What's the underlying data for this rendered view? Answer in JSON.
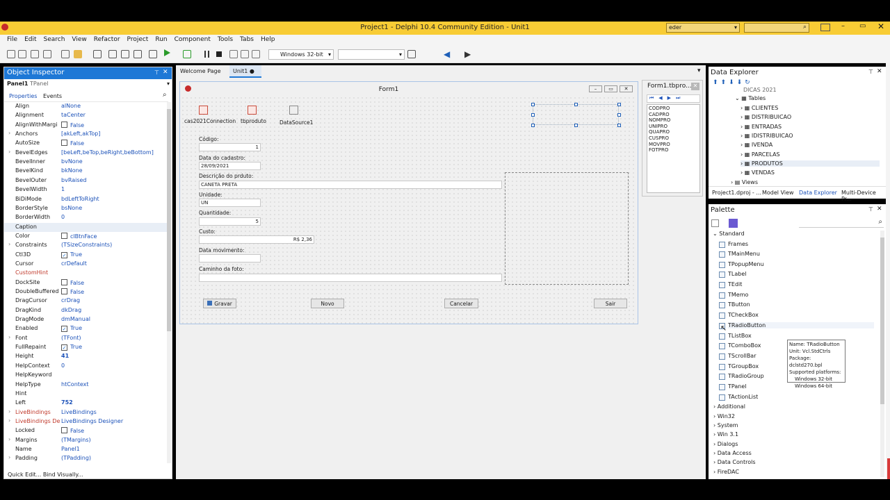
{
  "window": {
    "title": "Project1 - Delphi 10.4 Community Edition - Unit1",
    "user_combo": "eder"
  },
  "menu": [
    "File",
    "Edit",
    "Search",
    "View",
    "Refactor",
    "Project",
    "Run",
    "Component",
    "Tools",
    "Tabs",
    "Help"
  ],
  "toolbar": {
    "platform": "Windows 32-bit"
  },
  "object_inspector": {
    "title": "Object Inspector",
    "selected": "Panel1",
    "selected_type": "TPanel",
    "tabs": [
      "Properties",
      "Events"
    ],
    "properties": [
      {
        "name": "Align",
        "value": "alNone"
      },
      {
        "name": "Alignment",
        "value": "taCenter"
      },
      {
        "name": "AlignWithMargi",
        "value": "False",
        "check": "off"
      },
      {
        "name": "Anchors",
        "value": "[akLeft,akTop]"
      },
      {
        "name": "AutoSize",
        "value": "False",
        "check": "off"
      },
      {
        "name": "BevelEdges",
        "value": "[beLeft,beTop,beRight,beBottom]"
      },
      {
        "name": "BevelInner",
        "value": "bvNone"
      },
      {
        "name": "BevelKind",
        "value": "bkNone"
      },
      {
        "name": "BevelOuter",
        "value": "bvRaised"
      },
      {
        "name": "BevelWidth",
        "value": "1"
      },
      {
        "name": "BiDiMode",
        "value": "bdLeftToRight"
      },
      {
        "name": "BorderStyle",
        "value": "bsNone"
      },
      {
        "name": "BorderWidth",
        "value": "0"
      },
      {
        "name": "Caption",
        "value": ""
      },
      {
        "name": "Color",
        "value": "clBtnFace",
        "check": "off"
      },
      {
        "name": "Constraints",
        "value": "(TSizeConstraints)"
      },
      {
        "name": "Ctl3D",
        "value": "True",
        "check": "on"
      },
      {
        "name": "Cursor",
        "value": "crDefault"
      },
      {
        "name": "CustomHint",
        "value": ""
      },
      {
        "name": "DockSite",
        "value": "False",
        "check": "off"
      },
      {
        "name": "DoubleBuffered",
        "value": "False",
        "check": "off"
      },
      {
        "name": "DragCursor",
        "value": "crDrag"
      },
      {
        "name": "DragKind",
        "value": "dkDrag"
      },
      {
        "name": "DragMode",
        "value": "dmManual"
      },
      {
        "name": "Enabled",
        "value": "True",
        "check": "on"
      },
      {
        "name": "Font",
        "value": "(TFont)"
      },
      {
        "name": "FullRepaint",
        "value": "True",
        "check": "on"
      },
      {
        "name": "Height",
        "value": "41"
      },
      {
        "name": "HelpContext",
        "value": "0"
      },
      {
        "name": "HelpKeyword",
        "value": ""
      },
      {
        "name": "HelpType",
        "value": "htContext"
      },
      {
        "name": "Hint",
        "value": ""
      },
      {
        "name": "Left",
        "value": "752"
      },
      {
        "name": "LiveBindings",
        "value": "LiveBindings"
      },
      {
        "name": "LiveBindings De",
        "value": "LiveBindings Designer"
      },
      {
        "name": "Locked",
        "value": "False",
        "check": "off"
      },
      {
        "name": "Margins",
        "value": "(TMargins)"
      },
      {
        "name": "Name",
        "value": "Panel1"
      },
      {
        "name": "Padding",
        "value": "(TPadding)"
      }
    ],
    "footer": "Quick Edit...  Bind Visually..."
  },
  "editor_tabs": [
    "Welcome Page",
    "Unit1"
  ],
  "form": {
    "caption": "Form1",
    "components": [
      "cas2021Connection",
      "tbproduto",
      "DataSource1"
    ],
    "labels": {
      "codigo": "Código:",
      "data_cadastro": "Data do cadastro:",
      "descricao": "Descrição do prduto:",
      "unidade": "Unidade:",
      "quantidade": "Quantidade:",
      "custo": "Custo:",
      "data_mov": "Data movimento:",
      "caminho": "Caminho da foto:"
    },
    "values": {
      "codigo": "1",
      "data_cadastro": "28/09/2021",
      "descricao": "CANETA PRETA",
      "unidade": "UN",
      "quantidade": "5",
      "custo": "R$ 2,36"
    },
    "buttons": {
      "gravar": "Gravar",
      "novo": "Novo",
      "cancelar": "Cancelar",
      "sair": "Sair"
    }
  },
  "fields_window": {
    "title": "Form1.tbpro...",
    "fields": [
      "CODPRO",
      "CADPRO",
      "NOMPRO",
      "UNIPRO",
      "QUAPRO",
      "CUSPRO",
      "MOVPRO",
      "FOTPRO"
    ]
  },
  "data_explorer": {
    "title": "Data Explorer",
    "root": "DICAS 2021",
    "tables_label": "Tables",
    "tables": [
      "CLIENTES",
      "DISTRIBUICAO",
      "ENTRADAS",
      "IDISTRIBUICAO",
      "IVENDA",
      "PARCELAS",
      "PRODUTOS",
      "VENDAS"
    ],
    "views_label": "Views",
    "tabs": [
      "Project1.dproj - ...",
      "Model View",
      "Data Explorer",
      "Multi-Device Pr..."
    ]
  },
  "palette": {
    "title": "Palette",
    "category": "Standard",
    "items": [
      "Frames",
      "TMainMenu",
      "TPopupMenu",
      "TLabel",
      "TEdit",
      "TMemo",
      "TButton",
      "TCheckBox",
      "TRadioButton",
      "TListBox",
      "TComboBox",
      "TScrollBar",
      "TGroupBox",
      "TRadioGroup",
      "TPanel",
      "TActionList"
    ],
    "categories": [
      "Additional",
      "Win32",
      "System",
      "Win 3.1",
      "Dialogs",
      "Data Access",
      "Data Controls",
      "FireDAC"
    ],
    "tooltip": [
      "Name: TRadioButton",
      "Unit: Vcl.StdCtrls",
      "Package: dclstd270.bpl",
      "Supported platforms:",
      "Windows 32-bit",
      "Windows 64-bit"
    ]
  },
  "colors": {
    "title_bar": "#f8cc35",
    "panel_title": "#1e78d6",
    "value_text": "#1a50b8"
  }
}
